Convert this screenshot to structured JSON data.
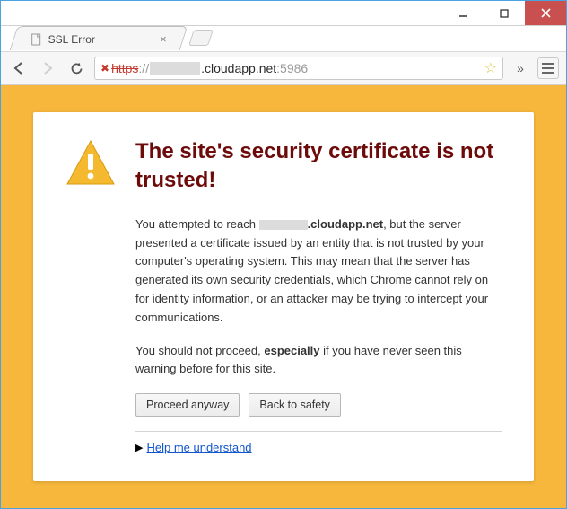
{
  "window": {
    "tab_title": "SSL Error"
  },
  "omnibox": {
    "scheme": "https",
    "sep": "://",
    "domain_suffix": ".cloudapp.net",
    "port": ":5986"
  },
  "error": {
    "heading": "The site's security certificate is not trusted!",
    "para1_pre": "You attempted to reach ",
    "para1_host_bold": ".cloudapp.net",
    "para1_post": ", but the server presented a certificate issued by an entity that is not trusted by your computer's operating system. This may mean that the server has generated its own security credentials, which Chrome cannot rely on for identity information, or an attacker may be trying to intercept your communications.",
    "para2_pre": "You should not proceed, ",
    "para2_strong": "especially",
    "para2_post": " if you have never seen this warning before for this site.",
    "proceed_label": "Proceed anyway",
    "back_label": "Back to safety",
    "help_label": "Help me understand"
  }
}
